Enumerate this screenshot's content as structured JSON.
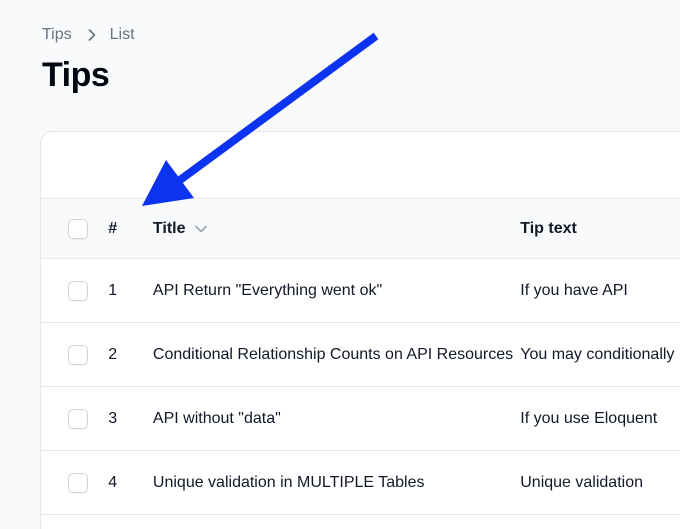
{
  "breadcrumb": {
    "items": [
      "Tips",
      "List"
    ]
  },
  "page": {
    "title": "Tips"
  },
  "table": {
    "columns": {
      "number": "#",
      "title": "Title",
      "tip_text": "Tip text"
    },
    "rows": [
      {
        "number": "1",
        "title": "API Return \"Everything went ok\"",
        "tip": "If you have API"
      },
      {
        "number": "2",
        "title": "Conditional Relationship Counts on API Resources",
        "tip": "You may conditionally"
      },
      {
        "number": "3",
        "title": "API without \"data\"",
        "tip": "If you use Eloquent"
      },
      {
        "number": "4",
        "title": "Unique validation in MULTIPLE Tables",
        "tip": "Unique validation"
      }
    ]
  },
  "annotation": {
    "color": "#0b33f0",
    "icon": "arrow-annotation-icon"
  },
  "colors": {
    "background": "#f9fafb",
    "border": "#e5e7eb",
    "text": "#111827",
    "muted": "#6b7280"
  }
}
